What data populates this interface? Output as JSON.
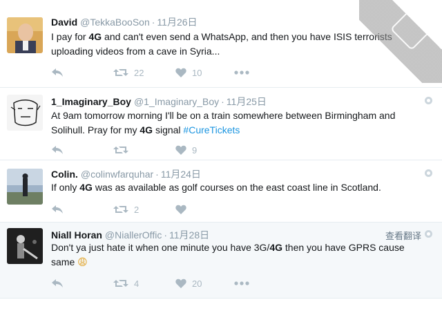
{
  "colors": {
    "name": "#14171a",
    "meta": "#8899a6",
    "action": "#aab8c2",
    "hashtag": "#1b95e0",
    "highlight_bg": "#f5f8fa",
    "divider": "#e6ecf0"
  },
  "tweets": [
    {
      "name": "David",
      "handle": "@TekkaBooSon",
      "sep": "·",
      "time": "11月26日",
      "text_a": "I pay for ",
      "kw": "4G",
      "text_b": " and can't even send a WhatsApp, and then you have ISIS terrorists uploading videos from a cave in Syria...",
      "reply_icon": "reply-icon",
      "retweet_icon": "retweet-icon",
      "retweets": "22",
      "like_icon": "heart-icon",
      "likes": "10",
      "more_icon": "more-icon"
    },
    {
      "name": "1_Imaginary_Boy",
      "handle": "@1_Imaginary_Boy",
      "sep": "·",
      "time": "11月25日",
      "text_a": "At 9am tomorrow morning I'll be on a train somewhere between Birmingham and Solihull. Pray for my ",
      "kw": "4G",
      "text_b": " signal ",
      "hashtag": "#CureTickets",
      "retweets": "",
      "likes": "9"
    },
    {
      "name": "Colin.",
      "handle": "@colinwfarquhar",
      "sep": "·",
      "time": "11月24日",
      "text_a": "If only ",
      "kw": "4G",
      "text_b": " was as available as golf courses on the east coast line in Scotland.",
      "retweets": "2",
      "likes": ""
    },
    {
      "name": "Niall Horan",
      "handle": "@NiallerOffic",
      "sep": "·",
      "time": "11月28日",
      "translate": "查看翻译",
      "text_a": "Don't ya just hate it when one minute you have 3G/",
      "kw": "4G",
      "text_b": " then you have GPRS cause same",
      "emoji": "😩",
      "retweets": "4",
      "likes": "20"
    }
  ],
  "watermark": {
    "logo": "watermark-logo"
  }
}
